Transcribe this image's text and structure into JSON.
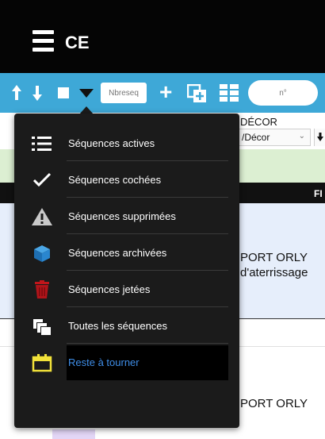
{
  "header": {
    "title": "CE",
    "menu_icon": "hamburger-icon"
  },
  "toolbar": {
    "up_icon": "arrow-up-icon",
    "down_icon": "arrow-down-icon",
    "checkbox_icon": "checkbox-icon",
    "caret_icon": "caret-down-icon",
    "number_placeholder": "Nbreseq",
    "add_icon": "plus-icon",
    "copy_icon": "copy-icon",
    "grid_icon": "grid-icon",
    "search_placeholder": "n°",
    "color": "#3ea8d7"
  },
  "background": {
    "decor_label": "DÉCOR",
    "decor_select_value": "/Décor",
    "column_letter": "FI",
    "row1_line1": "PORT ORLY",
    "row1_line2": "d'aterrissage",
    "row2_line1": "PORT ORLY"
  },
  "menu": {
    "items": [
      {
        "label": "Séquences actives",
        "icon": "list-icon"
      },
      {
        "label": "Séquences cochées",
        "icon": "checkmark-icon"
      },
      {
        "label": "Séquences supprimées",
        "icon": "warning-icon"
      },
      {
        "label": "Séquences archivées",
        "icon": "archive-box-icon"
      },
      {
        "label": "Séquences jetées",
        "icon": "trash-icon"
      },
      {
        "label": "Toutes les séquences",
        "icon": "stacked-copies-icon"
      },
      {
        "label": "Reste à tourner",
        "icon": "calendar-icon",
        "active": true
      }
    ],
    "active_label_color": "#3f8ee8",
    "bg_color": "#1b1b1b"
  }
}
